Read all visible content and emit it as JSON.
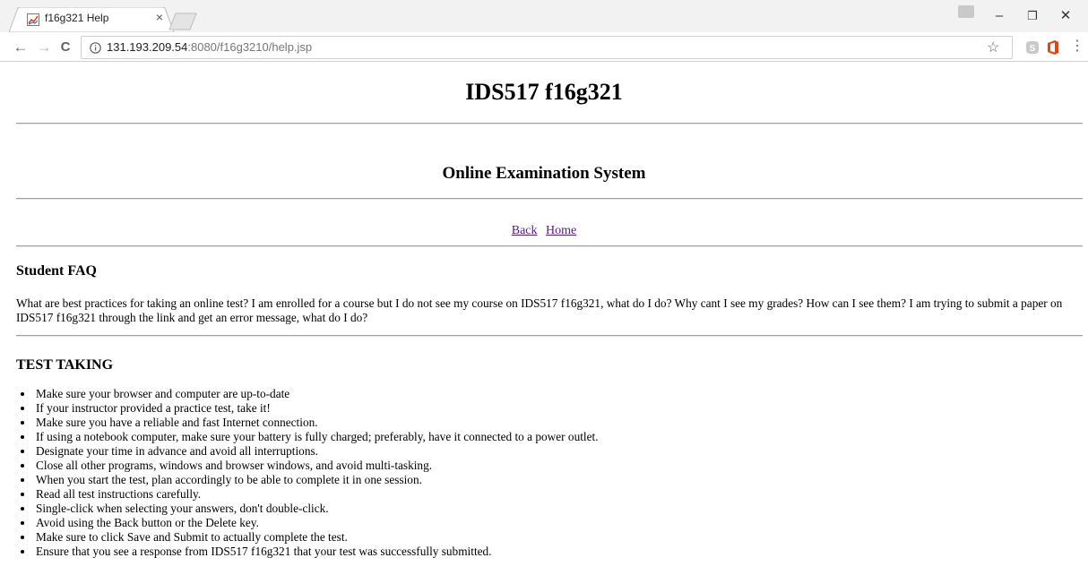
{
  "browser": {
    "tab_title": "f16g321 Help",
    "url_host": "131.193.209.54",
    "url_rest": ":8080/f16g3210/help.jsp"
  },
  "page": {
    "title": "IDS517 f16g321",
    "subtitle": "Online Examination System",
    "nav": {
      "back": "Back",
      "home": "Home"
    },
    "faq": {
      "heading": "Student FAQ",
      "text": "What are best practices for taking an online test? I am enrolled for a course but I do not see my course on IDS517 f16g321, what do I do? Why cant I see my grades? How can I see them? I am trying to submit a paper on IDS517 f16g321 through the link and get an error message, what do I do?"
    },
    "test_taking": {
      "heading": "TEST TAKING",
      "tips": [
        "Make sure your browser and computer are up-to-date",
        "If your instructor provided a practice test, take it!",
        "Make sure you have a reliable and fast Internet connection.",
        "If using a notebook computer, make sure your battery is fully charged; preferably, have it connected to a power outlet.",
        "Designate your time in advance and avoid all interruptions.",
        "Close all other programs, windows and browser windows, and avoid multi-tasking.",
        "When you start the test, plan accordingly to be able to complete it in one session.",
        "Read all test instructions carefully.",
        "Single-click when selecting your answers, don't double-click.",
        "Avoid using the Back button or the Delete key.",
        "Make sure to click Save and Submit to actually complete the test.",
        "Ensure that you see a response from IDS517 f16g321 that your test was successfully submitted."
      ]
    }
  },
  "colors": {
    "link_visited": "#551a8b",
    "rule": "#a0a0a0",
    "chrome_bg": "#f2f2f2"
  }
}
